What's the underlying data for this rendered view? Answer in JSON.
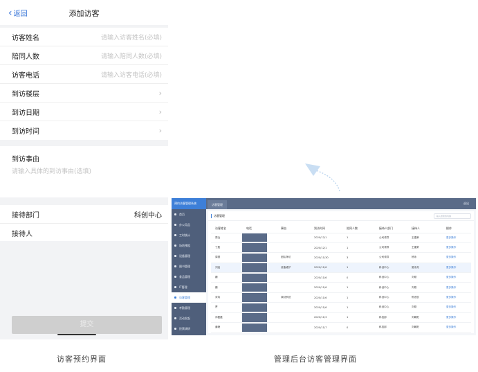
{
  "mobile": {
    "back_label": "返回",
    "title": "添加访客",
    "fields": [
      {
        "label": "访客姓名",
        "placeholder": "请输入访客姓名(必填)"
      },
      {
        "label": "陪同人数",
        "placeholder": "请输入陪同人数(必填)"
      },
      {
        "label": "访客电话",
        "placeholder": "请输入访客电话(必填)"
      }
    ],
    "pickers": [
      {
        "label": "到访楼层"
      },
      {
        "label": "到访日期"
      },
      {
        "label": "到访时间"
      }
    ],
    "reason": {
      "label": "到访事由",
      "placeholder": "请输入具体的到访事由(选填)"
    },
    "dept": {
      "label": "接待部门",
      "value": "科创中心"
    },
    "receiver": {
      "label": "接待人"
    },
    "submit_label": "提交",
    "caption": "访客预约界面"
  },
  "admin": {
    "brand": "预约访客管理系统",
    "tab": "访客管理",
    "user": "退出",
    "page_title": "访客管理",
    "search_placeholder": "输入搜索的内容",
    "sidebar": [
      "首页",
      "办公用品",
      "工时统计",
      "场地预租",
      "设备管理",
      "图书管理",
      "食品管理",
      "IT管理",
      "访客管理",
      "考勤管理",
      "活动发起",
      "投票调研"
    ],
    "columns": [
      "访客姓名",
      "电话",
      "事由",
      "到访时间",
      "陪同人数",
      "接待人部门",
      "接待人",
      "操作"
    ],
    "rows": [
      {
        "name": "周治",
        "reason": "",
        "time": "2020/12/1",
        "count": "1",
        "dept": "公司领导",
        "host": "王建荣",
        "op": "更多操作"
      },
      {
        "name": "丁胜",
        "reason": "",
        "time": "2020/12/1",
        "count": "1",
        "dept": "公司领导",
        "host": "王建荣",
        "op": "更多操作"
      },
      {
        "name": "周德",
        "reason": "团队拜访",
        "time": "2020/11/30",
        "count": "3",
        "dept": "公司领导",
        "host": "杨永",
        "op": "更多操作"
      },
      {
        "name": "刘迪",
        "reason": "设备维护",
        "time": "2020/11/6",
        "count": "1",
        "dept": "科创中心",
        "host": "夏永亮",
        "op": "更多操作"
      },
      {
        "name": "魏",
        "reason": "",
        "time": "2020/11/6",
        "count": "0",
        "dept": "科创中心",
        "host": "刘刚",
        "op": "更多操作"
      },
      {
        "name": "魏",
        "reason": "",
        "time": "2020/11/6",
        "count": "1",
        "dept": "科创中心",
        "host": "刘刚",
        "op": "更多操作"
      },
      {
        "name": "宋钧",
        "reason": "调试系统",
        "time": "2020/11/6",
        "count": "1",
        "dept": "科创中心",
        "host": "陈忠航",
        "op": "更多操作"
      },
      {
        "name": "贾",
        "reason": "",
        "time": "2020/11/6",
        "count": "1",
        "dept": "科创中心",
        "host": "刘刚",
        "op": "更多操作"
      },
      {
        "name": "邓磊磊",
        "reason": "",
        "time": "2020/11/3",
        "count": "1",
        "dept": "科技部",
        "host": "刘朝阳",
        "op": "更多操作"
      },
      {
        "name": "姜峰",
        "reason": "",
        "time": "2020/11/7",
        "count": "0",
        "dept": "科技部",
        "host": "刘朝阳",
        "op": "更多操作"
      }
    ],
    "caption": "管理后台访客管理界面"
  },
  "colors": {
    "primary": "#3d7fd8",
    "sidebar": "#4f5f7b",
    "topbar": "#5a6b88",
    "submit_disabled": "#cfcfcf",
    "link": "#2f6fd6"
  },
  "icons": {
    "back": "chevron-left-icon",
    "arrow": "chevron-right-icon",
    "decor": "curved-arrow-icon"
  }
}
